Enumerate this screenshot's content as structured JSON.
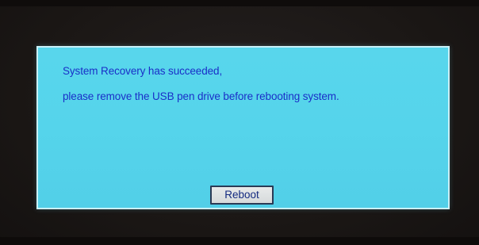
{
  "dialog": {
    "message_line_1": "System Recovery has succeeded,",
    "message_line_2": "please remove the USB pen drive before rebooting system.",
    "reboot_label": "Reboot"
  },
  "colors": {
    "dialog_background": "#55d4eb",
    "message_text": "#1a2fc8",
    "button_background": "#dfe2e3",
    "screen_background": "#1c1816"
  }
}
